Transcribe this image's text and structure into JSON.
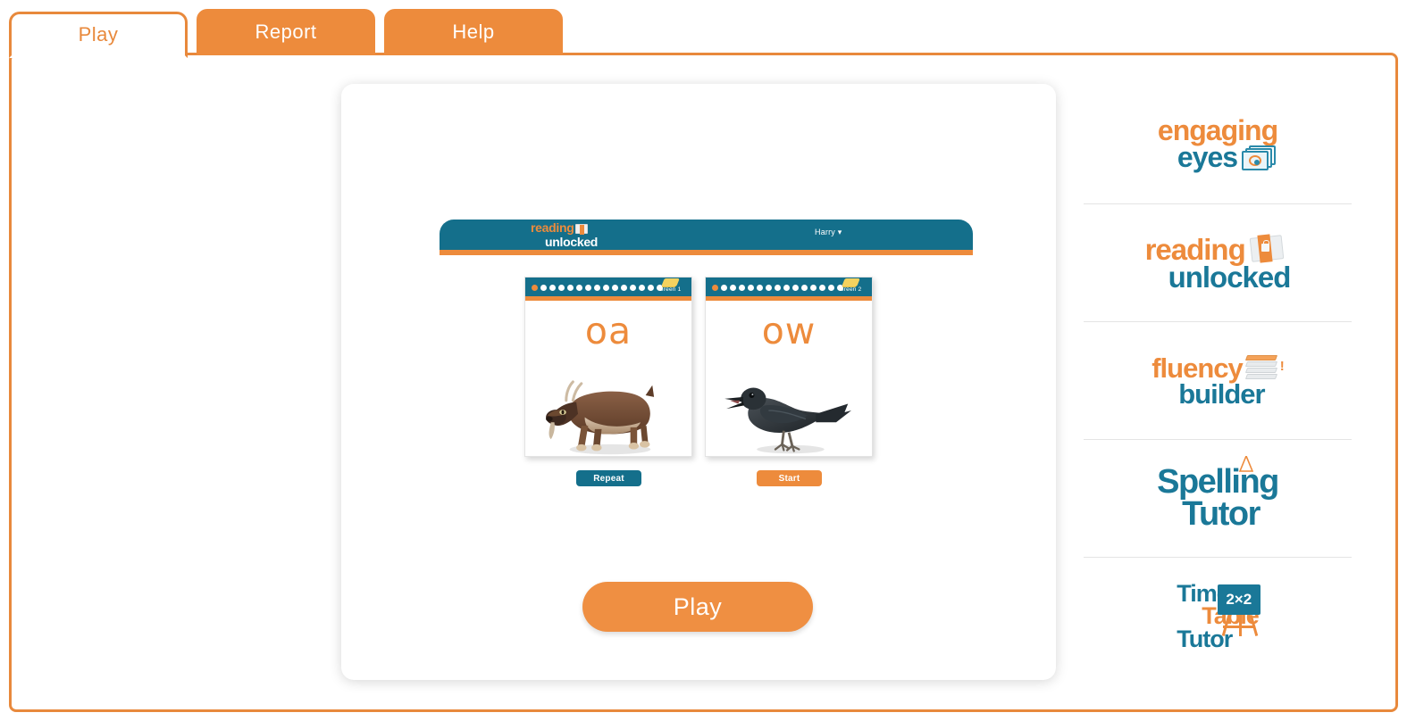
{
  "tabs": [
    {
      "label": "Play",
      "active": true
    },
    {
      "label": "Report",
      "active": false
    },
    {
      "label": "Help",
      "active": false
    }
  ],
  "game": {
    "header": {
      "logo_line1": "reading",
      "logo_line2": "unlocked",
      "logo_icon": "book-icon",
      "user_name": "Harry",
      "user_caret": "▾"
    },
    "cards": [
      {
        "grapheme": "oa",
        "image": "goat-illustration",
        "level_label": "Green 1",
        "level_icon": "gold-book-icon",
        "dots_total": 15,
        "dots_filled": 1,
        "button_label": "Repeat",
        "button_style": "teal"
      },
      {
        "grapheme": "ow",
        "image": "crow-illustration",
        "level_label": "Green 2",
        "level_icon": "gold-book-icon",
        "dots_total": 15,
        "dots_filled": 1,
        "button_label": "Start",
        "button_style": "orange"
      }
    ],
    "play_button_label": "Play"
  },
  "sidebar": {
    "brands": [
      {
        "name": "engaging-eyes",
        "line1": "engaging",
        "line2": "eyes",
        "line1_color": "#ed8b3c",
        "line2_color": "#1a7898",
        "icon": "eye-cards-icon"
      },
      {
        "name": "reading-unlocked",
        "line1": "reading",
        "line2": "unlocked",
        "line1_color": "#ed8b3c",
        "line2_color": "#1a7898",
        "icon": "locked-book-icon"
      },
      {
        "name": "fluency-builder",
        "line1": "fluency",
        "line2": "builder",
        "line1_color": "#ed8b3c",
        "line2_color": "#1a7898",
        "icon": "book-stack-icon"
      },
      {
        "name": "spelling-tutor",
        "line1": "Spelling",
        "line2": "Tutor",
        "line1_color": "#1a7898",
        "line2_color": "#1a7898",
        "icon": "pencil-icon"
      },
      {
        "name": "times-table-tutor",
        "line1": "Times",
        "line2": "Table",
        "line3": "Tutor",
        "line1_color": "#1a7898",
        "line2_color": "#ed8b3c",
        "line3_color": "#1a7898",
        "icon": "blackboard-easel-icon",
        "icon_text": "2×2"
      }
    ]
  },
  "colors": {
    "orange": "#ed8b3c",
    "teal": "#146f8b",
    "teal_brand": "#1a7898",
    "panel_white": "#ffffff",
    "gold": "#f3d25f"
  }
}
